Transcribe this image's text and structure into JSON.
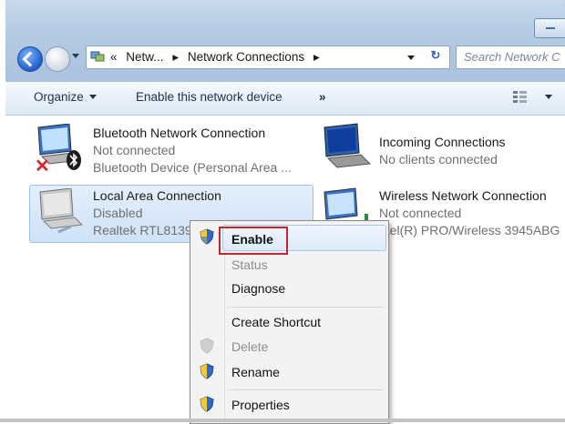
{
  "window": {
    "address_breadcrumb": [
      "«",
      "Netw...",
      "▸",
      "Network Connections",
      "▸"
    ],
    "search_placeholder": "Search Network C"
  },
  "toolbar": {
    "organize": "Organize",
    "enable_device": "Enable this network device",
    "more": "»"
  },
  "connections": [
    {
      "name": "Bluetooth Network Connection",
      "status": "Not connected",
      "device": "Bluetooth Device (Personal Area ..."
    },
    {
      "name": "Incoming Connections",
      "status": "No clients connected",
      "device": ""
    },
    {
      "name": "Local Area Connection",
      "status": "Disabled",
      "device": "Realtek RTL8139/"
    },
    {
      "name": "Wireless Network Connection",
      "status": "Not connected",
      "device": "ntel(R) PRO/Wireless 3945ABG"
    }
  ],
  "context_menu": {
    "items": [
      "Enable",
      "Status",
      "Diagnose",
      "Create Shortcut",
      "Delete",
      "Rename",
      "Properties"
    ]
  },
  "colors": {
    "accent": "#2a62b8",
    "highlight_box": "#c9232c",
    "selection": "#cfe2f7"
  }
}
